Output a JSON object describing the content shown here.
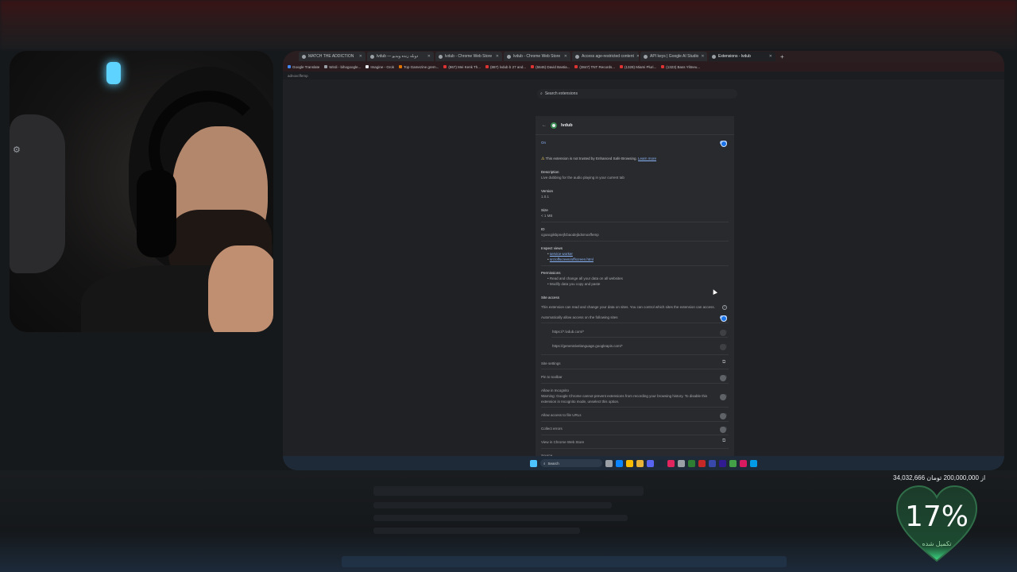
{
  "browser": {
    "tabs": [
      {
        "label": "MATCH THE ADDICTION"
      },
      {
        "label": "lvdub — دوبله زنده ویدیو"
      },
      {
        "label": "lvdub - Chrome Web Store"
      },
      {
        "label": "lvdub - Chrome Web Store"
      },
      {
        "label": "Access age-restricted content"
      },
      {
        "label": "API keys | Google AI Studio"
      },
      {
        "label": "Extensions - lvdub",
        "active": true
      }
    ],
    "new_tab": "+",
    "bookmarks": [
      "Google Translate",
      "Wirdi - bihogoogle...",
      "Imagine - Grok",
      "Top Gamezine grem...",
      "(867) Mei Kenk Th...",
      "(887) lvdub b 27 and...",
      "(5646) David Bastia...",
      "(3847) TNT Records...",
      "(1328) Miami Pluri...",
      "(1323) Bass Ylitneu..."
    ],
    "url_fragment": "adnoxcffemp"
  },
  "extensions_page": {
    "search_placeholder": "Search extensions",
    "extension_name": "lvdub",
    "on_label": "On",
    "warning_text": "This extension is not trusted by Enhanced Safe Browsing.",
    "learn_more": "Learn more",
    "description_label": "Description",
    "description": "Live dubbing for the audio playing in your current tab",
    "version_label": "Version",
    "version": "1.0.1",
    "size_label": "Size",
    "size": "< 1 MB",
    "id_label": "ID",
    "id_value": "cgoacgikbpnejfcbaodejbdsmoxffemp",
    "inspect_label": "Inspect views",
    "inspect_views": [
      "service worker",
      "src/offscreen/offscreen.html"
    ],
    "permissions_label": "Permissions",
    "permissions": [
      "Read and change all your data on all websites",
      "Modify data you copy and paste"
    ],
    "site_access_label": "Site access",
    "site_access_text": "This extension can read and change your data on sites. You can control which sites the extension can access.",
    "auto_allow_label": "Automatically allow access on the following sites",
    "sites": [
      "https://*.lvdub.com/*",
      "https://generativelanguage.googleapis.com/*"
    ],
    "site_settings": "Site settings",
    "pin_toolbar": "Pin to toolbar",
    "incognito_label": "Allow in Incognito",
    "incognito_warning": "Warning: Google Chrome cannot prevent extensions from recording your browsing history. To disable this extension in Incognito mode, unselect this option.",
    "file_urls": "Allow access to file URLs",
    "collect_errors": "Collect errors",
    "web_store": "View in Chrome Web Store",
    "source_label": "Source"
  },
  "taskbar": {
    "search_label": "Search"
  },
  "donation": {
    "amount_text": "34,032,666 از 200,000,000 تومان",
    "percent": "17%",
    "progress_fraction": 0.17,
    "subtitle": "تکمیل شده"
  },
  "colors": {
    "accent": "#8ab4f8",
    "heart": "#1f5e3a",
    "heart_glow": "#3ddc84"
  }
}
